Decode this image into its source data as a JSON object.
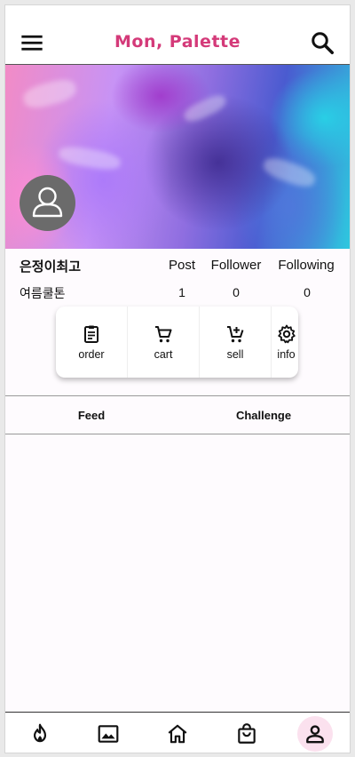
{
  "app": {
    "title": "Mon, Palette",
    "title_color": "#d43a79"
  },
  "profile": {
    "name": "은정이최고",
    "subtitle": "여름쿨톤",
    "stats": [
      {
        "label": "Post",
        "value": "1"
      },
      {
        "label": "Follower",
        "value": "0"
      },
      {
        "label": "Following",
        "value": "0"
      }
    ]
  },
  "actions": [
    {
      "label": "order",
      "icon": "clipboard-icon"
    },
    {
      "label": "cart",
      "icon": "cart-icon"
    },
    {
      "label": "sell",
      "icon": "cart-plus-icon"
    },
    {
      "label": "info",
      "icon": "gear-icon"
    }
  ],
  "tabs": [
    {
      "label": "Feed"
    },
    {
      "label": "Challenge"
    }
  ],
  "bottom_nav": [
    {
      "icon": "fire-icon",
      "active": false
    },
    {
      "icon": "gallery-icon",
      "active": false
    },
    {
      "icon": "home-icon",
      "active": false
    },
    {
      "icon": "shopping-bag-icon",
      "active": false
    },
    {
      "icon": "person-icon",
      "active": true
    }
  ],
  "colors": {
    "accent": "#d43a79",
    "active_nav_bg": "#fbe1ee"
  }
}
